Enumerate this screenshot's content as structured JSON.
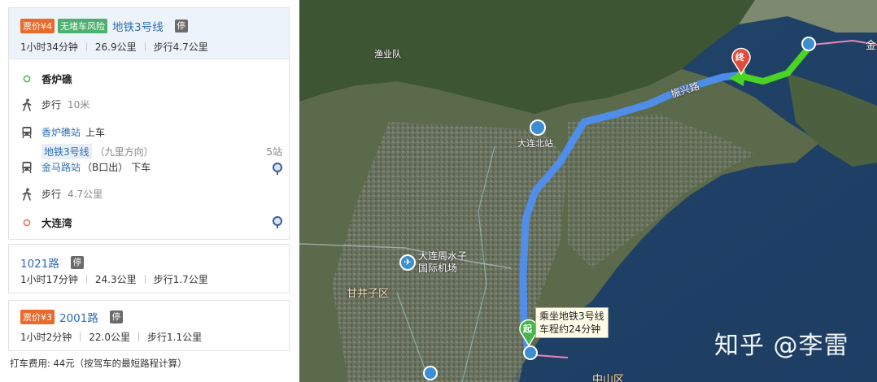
{
  "panel": {
    "route1": {
      "price": "票价¥4",
      "risk": "无堵车风险",
      "name": "地铁3号线",
      "stop_mark": "停",
      "duration": "1小时34分钟",
      "distance": "26.9公里",
      "walk": "步行4.7公里",
      "steps": {
        "origin": "香炉礁",
        "walk1_label": "步行",
        "walk1_dist": "10米",
        "board_station": "香炉礁站",
        "board_action": "上车",
        "line_tag": "地铁3号线",
        "direction": "（九里方向）",
        "stops": "5站",
        "alight_station": "金马路站",
        "alight_exit": "（B口出）",
        "alight_action": "下车",
        "walk2_label": "步行",
        "walk2_dist": "4.7公里",
        "destination": "大连湾"
      }
    },
    "route2": {
      "name": "1021路",
      "stop_mark": "停",
      "duration": "1小时17分钟",
      "distance": "24.3公里",
      "walk": "步行1.7公里"
    },
    "route3": {
      "price": "票价¥3",
      "name": "2001路",
      "stop_mark": "停",
      "duration": "1小时2分钟",
      "distance": "22.0公里",
      "walk": "步行1.1公里"
    },
    "fare": "打车费用: 44元（按驾车的最短路程计算）"
  },
  "map": {
    "labels": {
      "label_a": "渔业队",
      "road": "振兴路",
      "north_station": "大连北站",
      "airport": "大连周水子\n国际机场",
      "district1": "甘井子区",
      "district2": "中山区",
      "corner": "金"
    },
    "start_marker": "起",
    "end_marker": "终",
    "start_bubble_line1": "乘坐地铁3号线",
    "start_bubble_line2": "车程约24分钟",
    "watermark": "知乎 @李雷",
    "colors": {
      "route_blue": "#4f8ff0",
      "walk_green": "#4bd423",
      "end_red": "#e24b3b",
      "start_green": "#47b64a"
    }
  }
}
